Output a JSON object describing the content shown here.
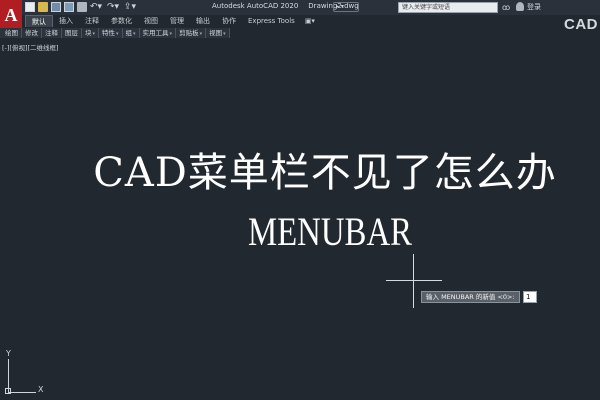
{
  "app": {
    "title": "Autodesk AutoCAD 2020",
    "file": "Drawing2.dwg",
    "menu_button_letter": "A",
    "corner_text": "CAD",
    "brand_color": "#b21d22"
  },
  "quick_access": [
    "new-icon",
    "open-icon",
    "save-icon",
    "save-as-icon",
    "print-icon",
    "undo-icon",
    "redo-icon",
    "share-icon"
  ],
  "search": {
    "placeholder": "键入关键字或短语"
  },
  "account": {
    "login_label": "登录"
  },
  "ribbon_tabs": [
    {
      "label": "默认",
      "active": true
    },
    {
      "label": "插入"
    },
    {
      "label": "注释"
    },
    {
      "label": "参数化"
    },
    {
      "label": "视图"
    },
    {
      "label": "管理"
    },
    {
      "label": "输出"
    },
    {
      "label": "协作"
    },
    {
      "label": "Express Tools"
    }
  ],
  "ribbon_panels": [
    "绘图",
    "修改",
    "注释",
    "图层",
    "块",
    "特性",
    "组",
    "实用工具",
    "剪贴板",
    "视图"
  ],
  "viewport_label": "[-][俯视][二维线框]",
  "overlay": {
    "heading_cn": "CAD菜单栏不见了怎么办",
    "heading_en": "MENUBAR"
  },
  "dynamic_input": {
    "prompt": "输入 MENUBAR 的新值 <0>:",
    "value": "1"
  },
  "ucs": {
    "x_label": "X",
    "y_label": "Y"
  }
}
